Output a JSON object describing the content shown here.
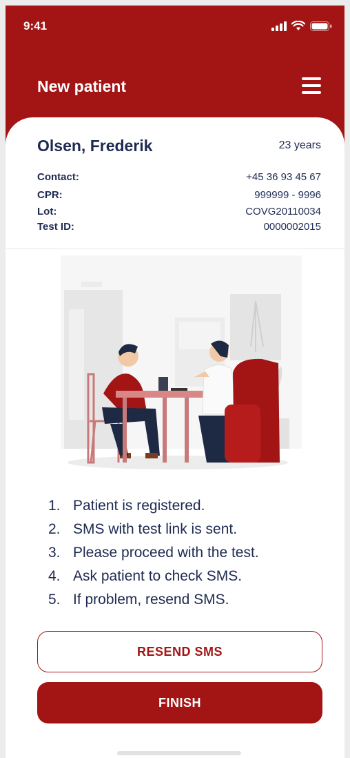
{
  "status_bar": {
    "time": "9:41"
  },
  "header": {
    "title": "New patient"
  },
  "patient": {
    "name": "Olsen, Frederik",
    "age": "23 years",
    "fields": [
      {
        "label": "Contact:",
        "value": "+45 36 93 45 67"
      },
      {
        "label": "CPR:",
        "value": "999999 - 9996"
      },
      {
        "label": "Lot:",
        "value": "COVG20110034"
      },
      {
        "label": "Test ID:",
        "value": "0000002015"
      }
    ]
  },
  "steps": [
    {
      "num": "1.",
      "text": "Patient is registered."
    },
    {
      "num": "2.",
      "text": "SMS with test link is sent."
    },
    {
      "num": "3.",
      "text": "Please proceed with the test."
    },
    {
      "num": "4.",
      "text": "Ask patient to check SMS."
    },
    {
      "num": "5.",
      "text": "If problem, resend SMS."
    }
  ],
  "actions": {
    "resend_label": "RESEND SMS",
    "finish_label": "FINISH"
  },
  "colors": {
    "brand": "#a31515",
    "text": "#1e2a52"
  }
}
